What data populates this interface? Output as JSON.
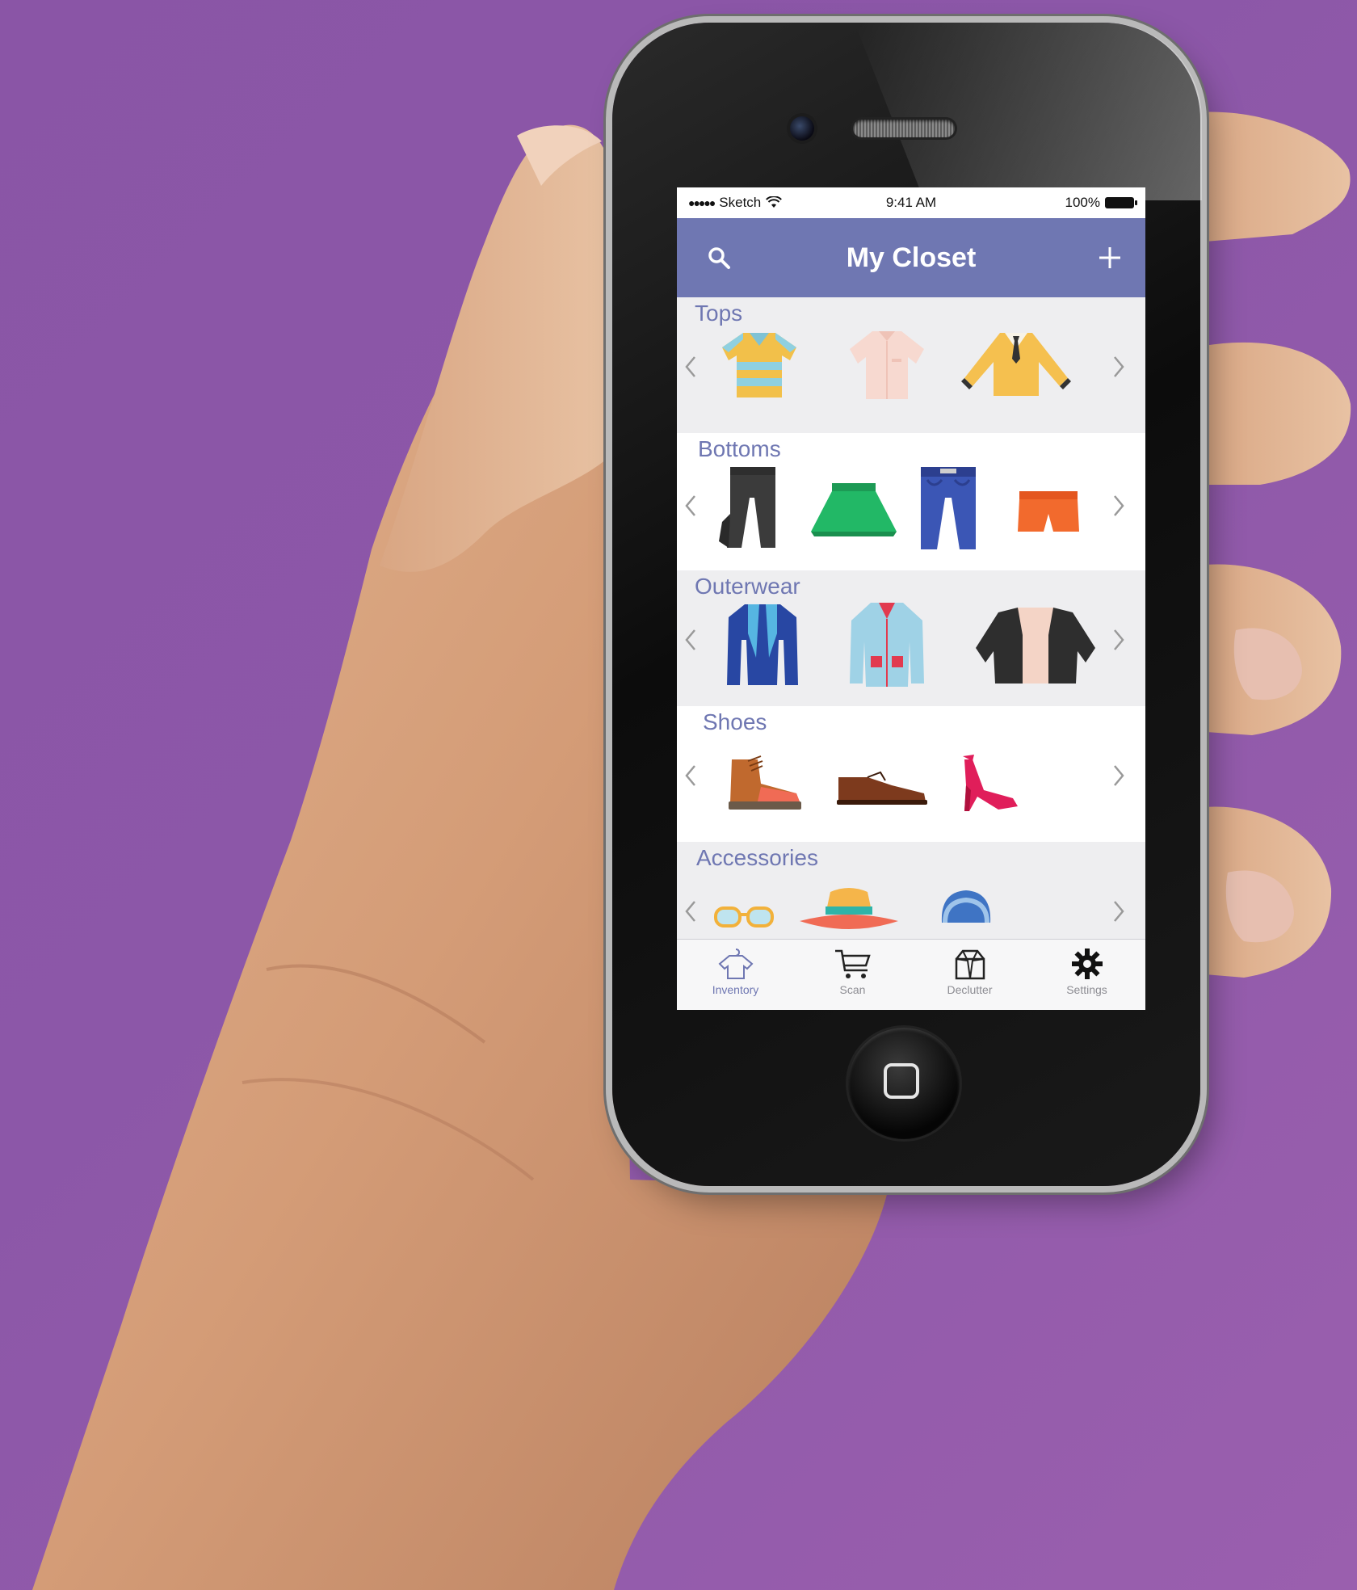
{
  "status_bar": {
    "carrier": "Sketch",
    "time": "9:41 AM",
    "battery": "100%"
  },
  "nav": {
    "title": "My Closet"
  },
  "sections": [
    {
      "title": "Tops",
      "items": [
        "striped-polo-shirt-icon",
        "pink-shirt-icon",
        "yellow-sweater-icon"
      ]
    },
    {
      "title": "Bottoms",
      "items": [
        "black-trousers-icon",
        "green-skirt-icon",
        "blue-jeans-icon",
        "orange-shorts-icon"
      ]
    },
    {
      "title": "Outerwear",
      "items": [
        "blue-blazer-icon",
        "light-blue-cardigan-icon",
        "black-jacket-icon"
      ]
    },
    {
      "title": "Shoes",
      "items": [
        "brown-boot-icon",
        "brown-oxford-shoe-icon",
        "red-high-heel-icon"
      ]
    },
    {
      "title": "Accessories",
      "items": [
        "glasses-icon",
        "sun-hat-icon",
        "baseball-cap-icon"
      ]
    }
  ],
  "tabbar": {
    "tabs": [
      {
        "label": "Inventory",
        "icon": "shirt-hanger-icon",
        "active": true
      },
      {
        "label": "Scan",
        "icon": "cart-icon",
        "active": false
      },
      {
        "label": "Declutter",
        "icon": "box-icon",
        "active": false
      },
      {
        "label": "Settings",
        "icon": "gear-icon",
        "active": false
      }
    ]
  },
  "colors": {
    "background": "#8a55a6",
    "nav_bar": "#6f77b2",
    "section_title": "#6f77b2",
    "section_alt_bg": "#eeeef0"
  }
}
